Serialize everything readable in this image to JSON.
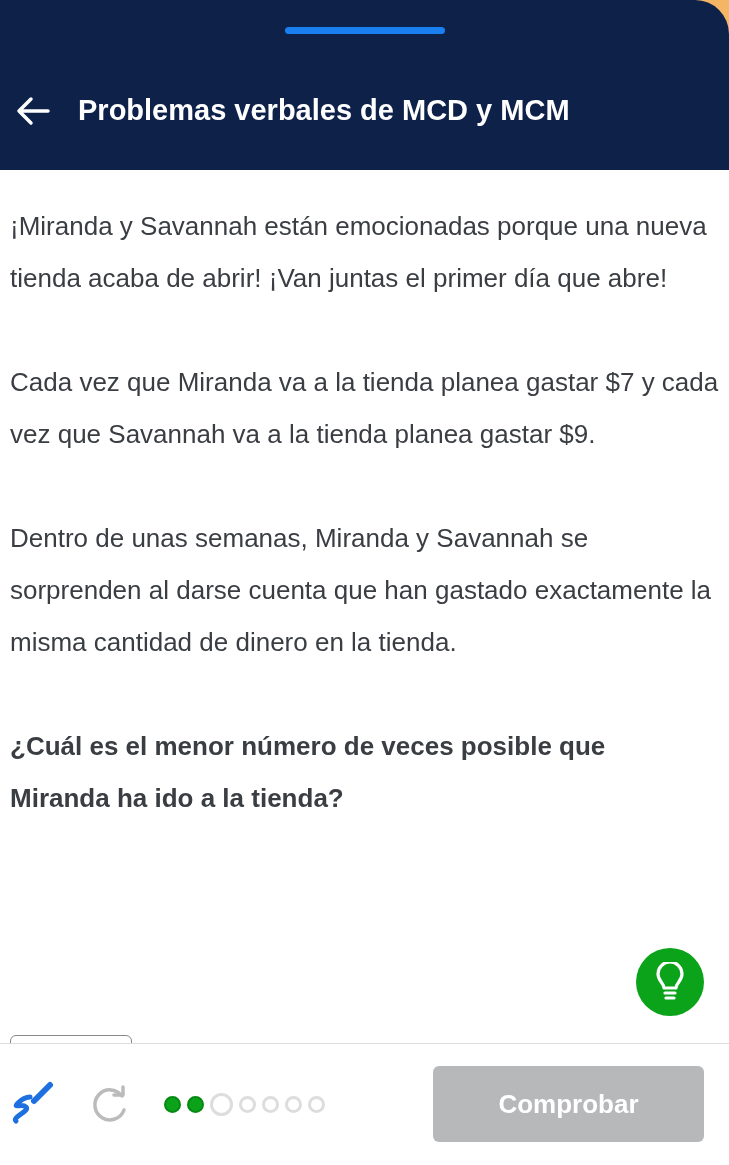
{
  "header": {
    "title": "Problemas verbales de MCD y MCM"
  },
  "paragraphs": [
    "¡Miranda y Savannah están emocionadas porque una nueva tienda acaba de abrir! ¡Van juntas el primer día que abre!",
    "Cada vez que Miranda va a la tienda planea gastar $7 y cada vez que Savannah va a la tienda planea gastar $9.",
    "Dentro de unas semanas, Miranda y Savannah se sorprenden al darse cuenta que han gastado exactamente la misma cantidad de dinero en la tienda."
  ],
  "question": "¿Cuál es el menor número de veces posible que Miranda ha ido a la tienda?",
  "progress": [
    {
      "kind": "done"
    },
    {
      "kind": "done"
    },
    {
      "kind": "current"
    },
    {
      "kind": "pending"
    },
    {
      "kind": "pending"
    },
    {
      "kind": "pending"
    },
    {
      "kind": "pending"
    }
  ],
  "check_button": {
    "label": "Comprobar",
    "disabled": true
  }
}
